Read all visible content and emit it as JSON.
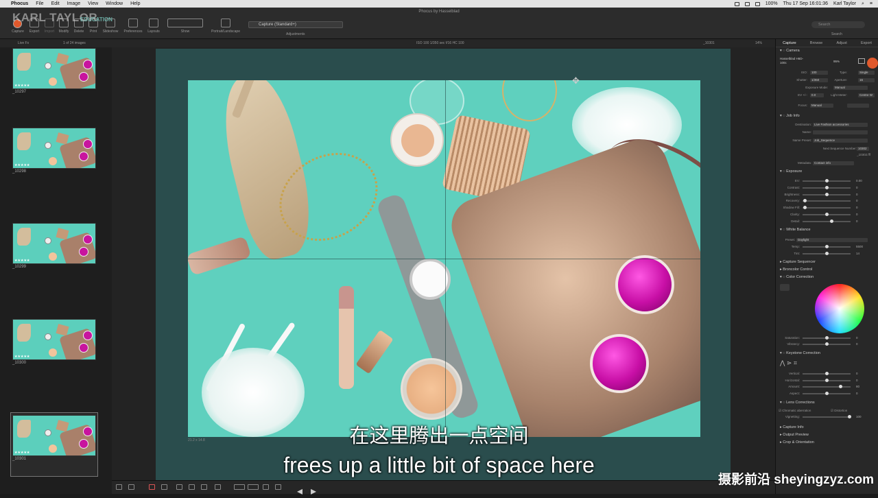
{
  "menubar": {
    "app": "Phocus",
    "items": [
      "File",
      "Edit",
      "Image",
      "View",
      "Window",
      "Help"
    ],
    "battery": "100%",
    "datetime": "Thu 17 Sep  16:01:36",
    "user": "Karl Taylor"
  },
  "window_title": "Phocus by Hasselblad",
  "logo": {
    "main": "KARL TAYLOR",
    "sub": "EDUCATION"
  },
  "toolbar": {
    "buttons": [
      "Capture",
      "Export",
      "Import",
      "Modify",
      "Delete",
      "Print",
      "Slideshow",
      "Preferences",
      "Layouts",
      "Show",
      "Portrait/Landscape"
    ],
    "preset": "Capture (Standard+)",
    "adjustments_label": "Adjustments",
    "search_placeholder": "Search",
    "search_label": "Search"
  },
  "subbar": {
    "live": "Live Fx",
    "count": "1 of 24 images",
    "exif": "ISO 100  1/350 sec  f/16  HC 100",
    "file": "_10301",
    "zoom": "14%"
  },
  "thumbnails": [
    {
      "label": "_10297"
    },
    {
      "label": "_10298"
    },
    {
      "label": "_10299"
    },
    {
      "label": "_10300"
    },
    {
      "label": "_10301"
    }
  ],
  "viewer": {
    "dimensions": "21.2 x 14.8"
  },
  "panel": {
    "tabs": [
      "Capture",
      "Browse",
      "Adjust",
      "Export"
    ],
    "camera": {
      "title": "Camera",
      "model": "Hasselblad H6D-100c",
      "battery": "95%",
      "iso_label": "ISO:",
      "iso": "100",
      "type_label": "Type:",
      "type": "Single",
      "shutter_label": "Shutter:",
      "shutter": "1/350",
      "aperture_label": "Aperture:",
      "aperture": "16",
      "exposure_mode_label": "Exposure Mode:",
      "exposure_mode": "Manual",
      "ev_label": "EV +/-:",
      "ev": "0.0",
      "light_meter_label": "Light Meter:",
      "light_meter": "Centre W",
      "focus_label": "Focus:",
      "focus": "Manual"
    },
    "job_info": {
      "title": "Job Info",
      "destination_label": "Destination:",
      "destination": "Live Fashion accessories",
      "name_label": "Name:",
      "name": "",
      "name_preset_label": "Name Preset:",
      "name_preset": "Job_Sequence",
      "next_seq_label": "Next Sequence Number:",
      "next_seq": "10302",
      "next_seq_file": "_10302.fff",
      "metadata_label": "Metadata:",
      "metadata": "Contact info"
    },
    "exposure": {
      "title": "Exposure",
      "rows": [
        {
          "label": "EV:",
          "value": "0.00"
        },
        {
          "label": "Contrast:",
          "value": "0"
        },
        {
          "label": "Brightness:",
          "value": "0"
        },
        {
          "label": "Recovery:",
          "value": "0"
        },
        {
          "label": "Shadow Fill:",
          "value": "0"
        },
        {
          "label": "Clarity:",
          "value": "0"
        },
        {
          "label": "Detail:",
          "value": "0"
        }
      ]
    },
    "white_balance": {
      "title": "White Balance",
      "preset_label": "Preset:",
      "preset": "Daylight",
      "temp_label": "Temp:",
      "temp": "5500",
      "tint_label": "Tint:",
      "tint": "14"
    },
    "sections_collapsed": [
      "Capture Sequencer",
      "Broncolor Control",
      "Color Correction"
    ],
    "color_correction": {
      "saturation_label": "Saturation:",
      "saturation": "0",
      "vibrancy_label": "Vibrancy:",
      "vibrancy": "0"
    },
    "keystone": {
      "title": "Keystone Correction",
      "rows": [
        {
          "label": "Vertical:",
          "value": "0"
        },
        {
          "label": "Horizontal:",
          "value": "0"
        },
        {
          "label": "Amount:",
          "value": "80"
        },
        {
          "label": "Aspect:",
          "value": "0"
        }
      ]
    },
    "lens": {
      "title": "Lens Corrections",
      "chromatic": "Chromatic aberration",
      "distortion": "Distortion",
      "vignetting_label": "Vignetting:",
      "vignetting": "100"
    },
    "more_sections": [
      "Capture Info",
      "Output Preview",
      "Crop & Orientation"
    ]
  },
  "subtitles": {
    "cn": "在这里腾出一点空间",
    "en": "frees up a little bit of space here"
  },
  "watermark": "摄影前沿 sheyingzyz.com"
}
